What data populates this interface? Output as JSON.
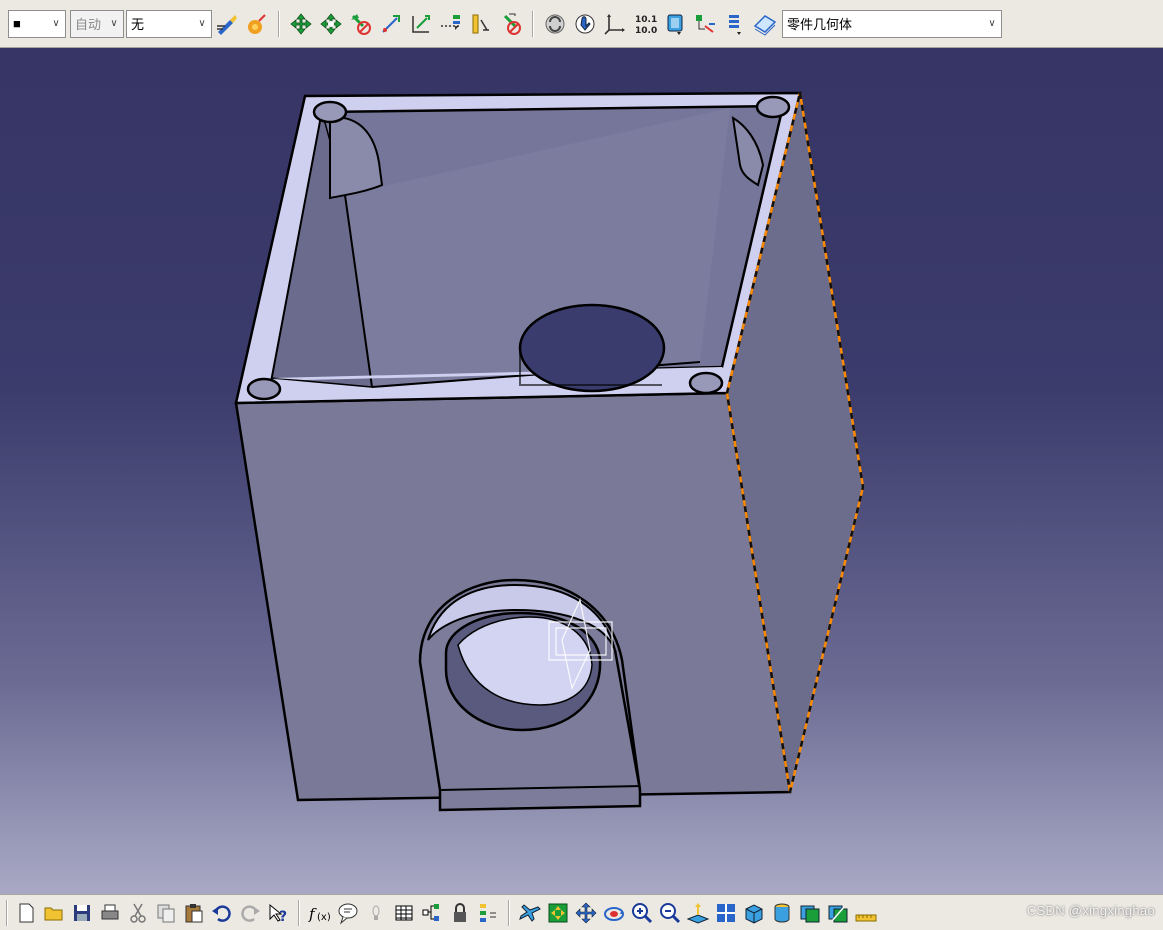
{
  "top_toolbar": {
    "color_combo_value": "■",
    "linetype_combo_value": "自动",
    "layer_combo_value": "无",
    "body_combo_value": "零件几何体"
  },
  "watermark": "CSDN @xingxinghao",
  "colors": {
    "toolbar_bg": "#ece9e2",
    "viewport_top": "#363565",
    "viewport_bottom": "#a9a9c5",
    "part_fill": "#7a7a98",
    "part_top_face": "#cfcff0",
    "highlight_edge": "#ff8a00"
  },
  "icons": {
    "top": [
      "graphic-properties-icon",
      "apply-material-icon",
      "constraint-icon",
      "constraint-defined-icon",
      "anchor-icon",
      "fix-icon",
      "distance-constraint-icon",
      "fix-together-icon",
      "parallel-icon",
      "update-icon",
      "sketch-icon",
      "axis-system-icon",
      "measure-icon",
      "3d-compass-icon",
      "boolean-icon",
      "tree-icon",
      "geometry-body-icon"
    ],
    "bottom": [
      "new-file-icon",
      "open-file-icon",
      "save-icon",
      "print-icon",
      "cut-icon",
      "copy-icon",
      "paste-icon",
      "undo-icon",
      "redo-icon",
      "whats-this-icon",
      "formula-icon",
      "knowledge-icon",
      "design-table-icon",
      "catalog-icon",
      "lock-icon",
      "tree-expand-icon",
      "fly-mode-icon",
      "fit-all-icon",
      "pan-icon",
      "rotate-icon",
      "zoom-in-icon",
      "zoom-out-icon",
      "normal-view-icon",
      "quick-view-icon",
      "iso-view-icon",
      "shading-icon",
      "hide-show-icon",
      "swap-space-icon",
      "measure-inertia-icon"
    ]
  }
}
